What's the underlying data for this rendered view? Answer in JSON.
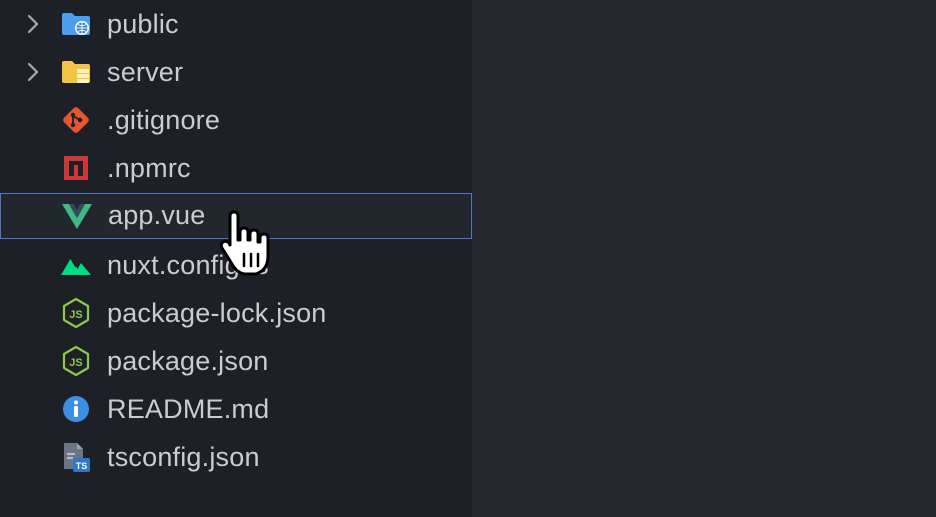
{
  "explorer": {
    "items": [
      {
        "label": "public",
        "icon": "folder-public-icon",
        "kind": "folder",
        "color": "#4a9ef0"
      },
      {
        "label": "server",
        "icon": "folder-server-icon",
        "kind": "folder",
        "color": "#f5c343"
      },
      {
        "label": ".gitignore",
        "icon": "git-icon",
        "kind": "file",
        "color": "#e4562f"
      },
      {
        "label": ".npmrc",
        "icon": "npm-icon",
        "kind": "file",
        "color": "#cb3837"
      },
      {
        "label": "app.vue",
        "icon": "vue-icon",
        "kind": "file",
        "color": "#41b883",
        "selected": true
      },
      {
        "label": "nuxt.config.ts",
        "icon": "nuxt-icon",
        "kind": "file",
        "color": "#00dc82"
      },
      {
        "label": "package-lock.json",
        "icon": "nodejs-icon",
        "kind": "file",
        "color": "#8cc84b"
      },
      {
        "label": "package.json",
        "icon": "nodejs-icon",
        "kind": "file",
        "color": "#8cc84b"
      },
      {
        "label": "README.md",
        "icon": "info-icon",
        "kind": "file",
        "color": "#3d8fe6"
      },
      {
        "label": "tsconfig.json",
        "icon": "tsconfig-icon",
        "kind": "file",
        "color": "#3178c6"
      }
    ]
  },
  "colors": {
    "selection_border": "#4d78cc",
    "sidebar_bg": "#1d2026",
    "editor_bg": "#24272d",
    "text": "#c9cdd3"
  },
  "cursor": {
    "icon": "hand-pointer-icon"
  }
}
